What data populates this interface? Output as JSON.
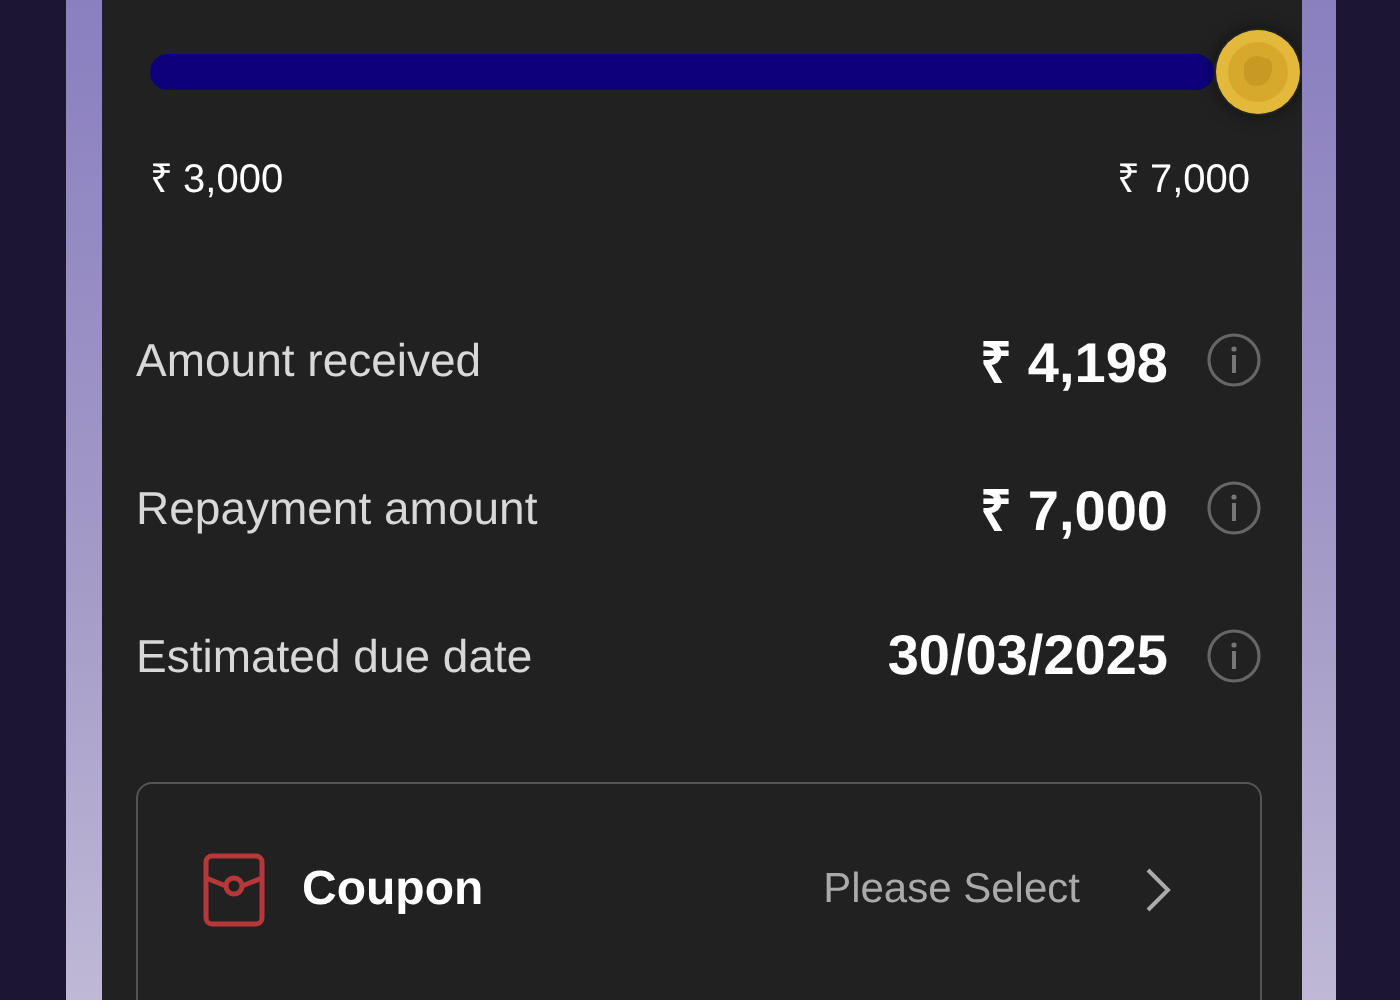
{
  "slider": {
    "level": 1,
    "min_label": "₹ 3,000",
    "max_label": "₹ 7,000"
  },
  "details": [
    {
      "label": "Amount received",
      "value": "₹ 4,198"
    },
    {
      "label": "Repayment amount",
      "value": "₹ 7,000"
    },
    {
      "label": "Estimated due date",
      "value": "30/03/2025"
    }
  ],
  "coupon": {
    "label": "Coupon",
    "value": "Please Select"
  }
}
